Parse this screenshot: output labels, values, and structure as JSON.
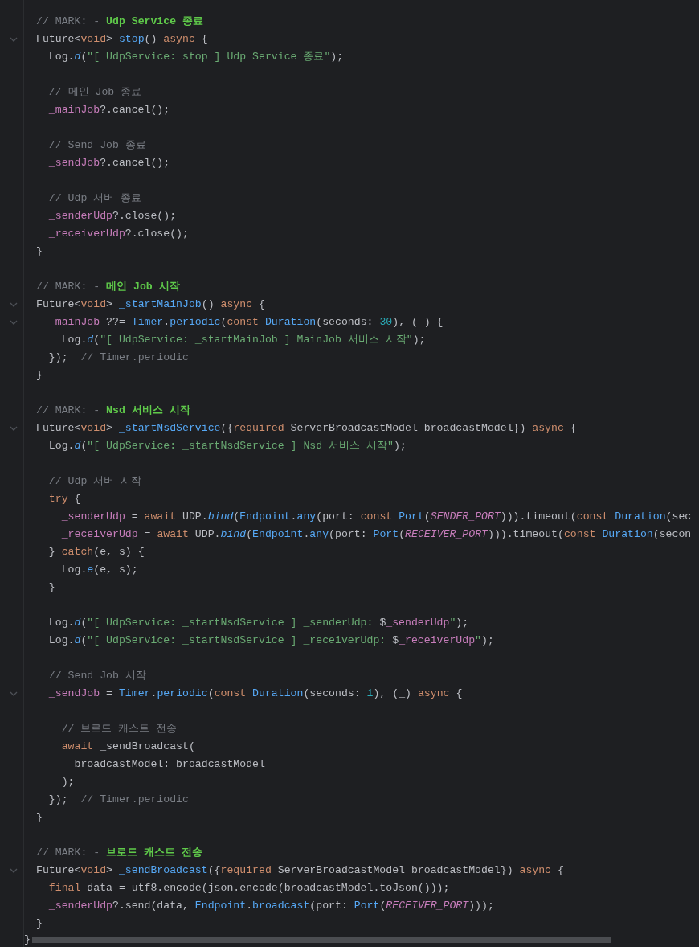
{
  "editor": {
    "lines": [
      {
        "fold": false,
        "segments": [
          {
            "kind": "comment",
            "text": "// MARK: - "
          },
          {
            "kind": "mark",
            "text": "Udp Service 종료"
          }
        ]
      },
      {
        "fold": true,
        "segments": [
          {
            "kind": "plain",
            "text": "Future<"
          },
          {
            "kind": "keyword",
            "text": "void"
          },
          {
            "kind": "plain",
            "text": "> "
          },
          {
            "kind": "function",
            "text": "stop"
          },
          {
            "kind": "plain",
            "text": "() "
          },
          {
            "kind": "keyword",
            "text": "async"
          },
          {
            "kind": "plain",
            "text": " {"
          }
        ]
      },
      {
        "fold": false,
        "segments": [
          {
            "kind": "plain",
            "text": "  Log."
          },
          {
            "kind": "italic_function",
            "text": "d"
          },
          {
            "kind": "plain",
            "text": "("
          },
          {
            "kind": "string",
            "text": "\"[ UdpService: stop ] Udp Service 종료\""
          },
          {
            "kind": "plain",
            "text": ");"
          }
        ]
      },
      {
        "fold": false
      },
      {
        "fold": false,
        "segments": [
          {
            "kind": "comment",
            "text": "  // 메인 Job 종료"
          }
        ]
      },
      {
        "fold": false,
        "segments": [
          {
            "kind": "field",
            "text": "  _mainJob"
          },
          {
            "kind": "plain",
            "text": "?.cancel();"
          }
        ]
      },
      {
        "fold": false
      },
      {
        "fold": false,
        "segments": [
          {
            "kind": "comment",
            "text": "  // Send Job 종료"
          }
        ]
      },
      {
        "fold": false,
        "segments": [
          {
            "kind": "field",
            "text": "  _sendJob"
          },
          {
            "kind": "plain",
            "text": "?.cancel();"
          }
        ]
      },
      {
        "fold": false
      },
      {
        "fold": false,
        "segments": [
          {
            "kind": "comment",
            "text": "  // Udp 서버 종료"
          }
        ]
      },
      {
        "fold": false,
        "segments": [
          {
            "kind": "field",
            "text": "  _senderUdp"
          },
          {
            "kind": "plain",
            "text": "?.close();"
          }
        ]
      },
      {
        "fold": false,
        "segments": [
          {
            "kind": "field",
            "text": "  _receiverUdp"
          },
          {
            "kind": "plain",
            "text": "?.close();"
          }
        ]
      },
      {
        "fold": false,
        "segments": [
          {
            "kind": "plain",
            "text": "}"
          }
        ]
      },
      {
        "fold": false
      },
      {
        "fold": false,
        "segments": [
          {
            "kind": "comment",
            "text": "// MARK: - "
          },
          {
            "kind": "mark",
            "text": "메인 Job 시작"
          }
        ]
      },
      {
        "fold": true,
        "segments": [
          {
            "kind": "plain",
            "text": "Future<"
          },
          {
            "kind": "keyword",
            "text": "void"
          },
          {
            "kind": "plain",
            "text": "> "
          },
          {
            "kind": "function",
            "text": "_startMainJob"
          },
          {
            "kind": "plain",
            "text": "() "
          },
          {
            "kind": "keyword",
            "text": "async"
          },
          {
            "kind": "plain",
            "text": " {"
          }
        ]
      },
      {
        "fold": true,
        "segments": [
          {
            "kind": "field",
            "text": "  _mainJob"
          },
          {
            "kind": "plain",
            "text": " ??= "
          },
          {
            "kind": "function",
            "text": "Timer"
          },
          {
            "kind": "plain",
            "text": "."
          },
          {
            "kind": "function",
            "text": "periodic"
          },
          {
            "kind": "plain",
            "text": "("
          },
          {
            "kind": "keyword",
            "text": "const "
          },
          {
            "kind": "function",
            "text": "Duration"
          },
          {
            "kind": "plain",
            "text": "(seconds: "
          },
          {
            "kind": "number",
            "text": "30"
          },
          {
            "kind": "plain",
            "text": "), (_) {"
          }
        ]
      },
      {
        "fold": false,
        "segments": [
          {
            "kind": "plain",
            "text": "    Log."
          },
          {
            "kind": "italic_function",
            "text": "d"
          },
          {
            "kind": "plain",
            "text": "("
          },
          {
            "kind": "string",
            "text": "\"[ UdpService: _startMainJob ] MainJob 서비스 시작\""
          },
          {
            "kind": "plain",
            "text": ");"
          }
        ]
      },
      {
        "fold": false,
        "segments": [
          {
            "kind": "plain",
            "text": "  });  "
          },
          {
            "kind": "comment",
            "text": "// Timer.periodic"
          }
        ]
      },
      {
        "fold": false,
        "segments": [
          {
            "kind": "plain",
            "text": "}"
          }
        ]
      },
      {
        "fold": false
      },
      {
        "fold": false,
        "segments": [
          {
            "kind": "comment",
            "text": "// MARK: - "
          },
          {
            "kind": "mark",
            "text": "Nsd 서비스 시작"
          }
        ]
      },
      {
        "fold": true,
        "segments": [
          {
            "kind": "plain",
            "text": "Future<"
          },
          {
            "kind": "keyword",
            "text": "void"
          },
          {
            "kind": "plain",
            "text": "> "
          },
          {
            "kind": "function",
            "text": "_startNsdService"
          },
          {
            "kind": "plain",
            "text": "({"
          },
          {
            "kind": "keyword",
            "text": "required"
          },
          {
            "kind": "plain",
            "text": " ServerBroadcastModel broadcastModel}) "
          },
          {
            "kind": "keyword",
            "text": "async"
          },
          {
            "kind": "plain",
            "text": " {"
          }
        ]
      },
      {
        "fold": false,
        "segments": [
          {
            "kind": "plain",
            "text": "  Log."
          },
          {
            "kind": "italic_function",
            "text": "d"
          },
          {
            "kind": "plain",
            "text": "("
          },
          {
            "kind": "string",
            "text": "\"[ UdpService: _startNsdService ] Nsd 서비스 시작\""
          },
          {
            "kind": "plain",
            "text": ");"
          }
        ]
      },
      {
        "fold": false
      },
      {
        "fold": false,
        "segments": [
          {
            "kind": "comment",
            "text": "  // Udp 서버 시작"
          }
        ]
      },
      {
        "fold": false,
        "segments": [
          {
            "kind": "keyword",
            "text": "  try"
          },
          {
            "kind": "plain",
            "text": " {"
          }
        ]
      },
      {
        "fold": false,
        "segments": [
          {
            "kind": "field",
            "text": "    _senderUdp"
          },
          {
            "kind": "plain",
            "text": " = "
          },
          {
            "kind": "keyword",
            "text": "await"
          },
          {
            "kind": "plain",
            "text": " UDP."
          },
          {
            "kind": "italic_function",
            "text": "bind"
          },
          {
            "kind": "plain",
            "text": "("
          },
          {
            "kind": "function",
            "text": "Endpoint"
          },
          {
            "kind": "plain",
            "text": "."
          },
          {
            "kind": "function",
            "text": "any"
          },
          {
            "kind": "plain",
            "text": "(port: "
          },
          {
            "kind": "keyword",
            "text": "const "
          },
          {
            "kind": "function",
            "text": "Port"
          },
          {
            "kind": "plain",
            "text": "("
          },
          {
            "kind": "constant",
            "text": "SENDER_PORT"
          },
          {
            "kind": "plain",
            "text": "))).timeout("
          },
          {
            "kind": "keyword",
            "text": "const "
          },
          {
            "kind": "function",
            "text": "Duration"
          },
          {
            "kind": "plain",
            "text": "(sec"
          }
        ]
      },
      {
        "fold": false,
        "segments": [
          {
            "kind": "field",
            "text": "    _receiverUdp"
          },
          {
            "kind": "plain",
            "text": " = "
          },
          {
            "kind": "keyword",
            "text": "await"
          },
          {
            "kind": "plain",
            "text": " UDP."
          },
          {
            "kind": "italic_function",
            "text": "bind"
          },
          {
            "kind": "plain",
            "text": "("
          },
          {
            "kind": "function",
            "text": "Endpoint"
          },
          {
            "kind": "plain",
            "text": "."
          },
          {
            "kind": "function",
            "text": "any"
          },
          {
            "kind": "plain",
            "text": "(port: "
          },
          {
            "kind": "function",
            "text": "Port"
          },
          {
            "kind": "plain",
            "text": "("
          },
          {
            "kind": "constant",
            "text": "RECEIVER_PORT"
          },
          {
            "kind": "plain",
            "text": "))).timeout("
          },
          {
            "kind": "keyword",
            "text": "const "
          },
          {
            "kind": "function",
            "text": "Duration"
          },
          {
            "kind": "plain",
            "text": "(secon"
          }
        ]
      },
      {
        "fold": false,
        "segments": [
          {
            "kind": "plain",
            "text": "  } "
          },
          {
            "kind": "keyword",
            "text": "catch"
          },
          {
            "kind": "plain",
            "text": "(e, s) {"
          }
        ]
      },
      {
        "fold": false,
        "segments": [
          {
            "kind": "plain",
            "text": "    Log."
          },
          {
            "kind": "italic_function",
            "text": "e"
          },
          {
            "kind": "plain",
            "text": "(e, s);"
          }
        ]
      },
      {
        "fold": false,
        "segments": [
          {
            "kind": "plain",
            "text": "  }"
          }
        ]
      },
      {
        "fold": false
      },
      {
        "fold": false,
        "segments": [
          {
            "kind": "plain",
            "text": "  Log."
          },
          {
            "kind": "italic_function",
            "text": "d"
          },
          {
            "kind": "plain",
            "text": "("
          },
          {
            "kind": "string",
            "text": "\"[ UdpService: _startNsdService ] _senderUdp: "
          },
          {
            "kind": "plain",
            "text": "$"
          },
          {
            "kind": "field",
            "text": "_senderUdp"
          },
          {
            "kind": "string",
            "text": "\""
          },
          {
            "kind": "plain",
            "text": ");"
          }
        ]
      },
      {
        "fold": false,
        "segments": [
          {
            "kind": "plain",
            "text": "  Log."
          },
          {
            "kind": "italic_function",
            "text": "d"
          },
          {
            "kind": "plain",
            "text": "("
          },
          {
            "kind": "string",
            "text": "\"[ UdpService: _startNsdService ] _receiverUdp: "
          },
          {
            "kind": "plain",
            "text": "$"
          },
          {
            "kind": "field",
            "text": "_receiverUdp"
          },
          {
            "kind": "string",
            "text": "\""
          },
          {
            "kind": "plain",
            "text": ");"
          }
        ]
      },
      {
        "fold": false
      },
      {
        "fold": false,
        "segments": [
          {
            "kind": "comment",
            "text": "  // Send Job 시작"
          }
        ]
      },
      {
        "fold": true,
        "segments": [
          {
            "kind": "field",
            "text": "  _sendJob"
          },
          {
            "kind": "plain",
            "text": " = "
          },
          {
            "kind": "function",
            "text": "Timer"
          },
          {
            "kind": "plain",
            "text": "."
          },
          {
            "kind": "function",
            "text": "periodic"
          },
          {
            "kind": "plain",
            "text": "("
          },
          {
            "kind": "keyword",
            "text": "const "
          },
          {
            "kind": "function",
            "text": "Duration"
          },
          {
            "kind": "plain",
            "text": "(seconds: "
          },
          {
            "kind": "number",
            "text": "1"
          },
          {
            "kind": "plain",
            "text": "), (_) "
          },
          {
            "kind": "keyword",
            "text": "async"
          },
          {
            "kind": "plain",
            "text": " {"
          }
        ]
      },
      {
        "fold": false
      },
      {
        "fold": false,
        "segments": [
          {
            "kind": "comment",
            "text": "    // 브로드 캐스트 전송"
          }
        ]
      },
      {
        "fold": false,
        "segments": [
          {
            "kind": "keyword",
            "text": "    await"
          },
          {
            "kind": "plain",
            "text": " _sendBroadcast("
          }
        ]
      },
      {
        "fold": false,
        "segments": [
          {
            "kind": "plain",
            "text": "      broadcastModel: broadcastModel"
          }
        ]
      },
      {
        "fold": false,
        "segments": [
          {
            "kind": "plain",
            "text": "    );"
          }
        ]
      },
      {
        "fold": false,
        "segments": [
          {
            "kind": "plain",
            "text": "  });  "
          },
          {
            "kind": "comment",
            "text": "// Timer.periodic"
          }
        ]
      },
      {
        "fold": false,
        "segments": [
          {
            "kind": "plain",
            "text": "}"
          }
        ]
      },
      {
        "fold": false
      },
      {
        "fold": false,
        "segments": [
          {
            "kind": "comment",
            "text": "// MARK: - "
          },
          {
            "kind": "mark",
            "text": "브로드 캐스트 전송"
          }
        ]
      },
      {
        "fold": true,
        "segments": [
          {
            "kind": "plain",
            "text": "Future<"
          },
          {
            "kind": "keyword",
            "text": "void"
          },
          {
            "kind": "plain",
            "text": "> "
          },
          {
            "kind": "function",
            "text": "_sendBroadcast"
          },
          {
            "kind": "plain",
            "text": "({"
          },
          {
            "kind": "keyword",
            "text": "required"
          },
          {
            "kind": "plain",
            "text": " ServerBroadcastModel broadcastModel}) "
          },
          {
            "kind": "keyword",
            "text": "async"
          },
          {
            "kind": "plain",
            "text": " {"
          }
        ]
      },
      {
        "fold": false,
        "segments": [
          {
            "kind": "keyword",
            "text": "  final"
          },
          {
            "kind": "plain",
            "text": " data = utf8.encode(json.encode(broadcastModel.toJson()));"
          }
        ]
      },
      {
        "fold": false,
        "segments": [
          {
            "kind": "field",
            "text": "  _senderUdp"
          },
          {
            "kind": "plain",
            "text": "?.send(data, "
          },
          {
            "kind": "function",
            "text": "Endpoint"
          },
          {
            "kind": "plain",
            "text": "."
          },
          {
            "kind": "function",
            "text": "broadcast"
          },
          {
            "kind": "plain",
            "text": "(port: "
          },
          {
            "kind": "function",
            "text": "Port"
          },
          {
            "kind": "plain",
            "text": "("
          },
          {
            "kind": "constant",
            "text": "RECEIVER_PORT"
          },
          {
            "kind": "plain",
            "text": ")));"
          }
        ]
      },
      {
        "fold": false,
        "segments": [
          {
            "kind": "plain",
            "text": "}"
          }
        ]
      }
    ],
    "closing_line": "}"
  }
}
